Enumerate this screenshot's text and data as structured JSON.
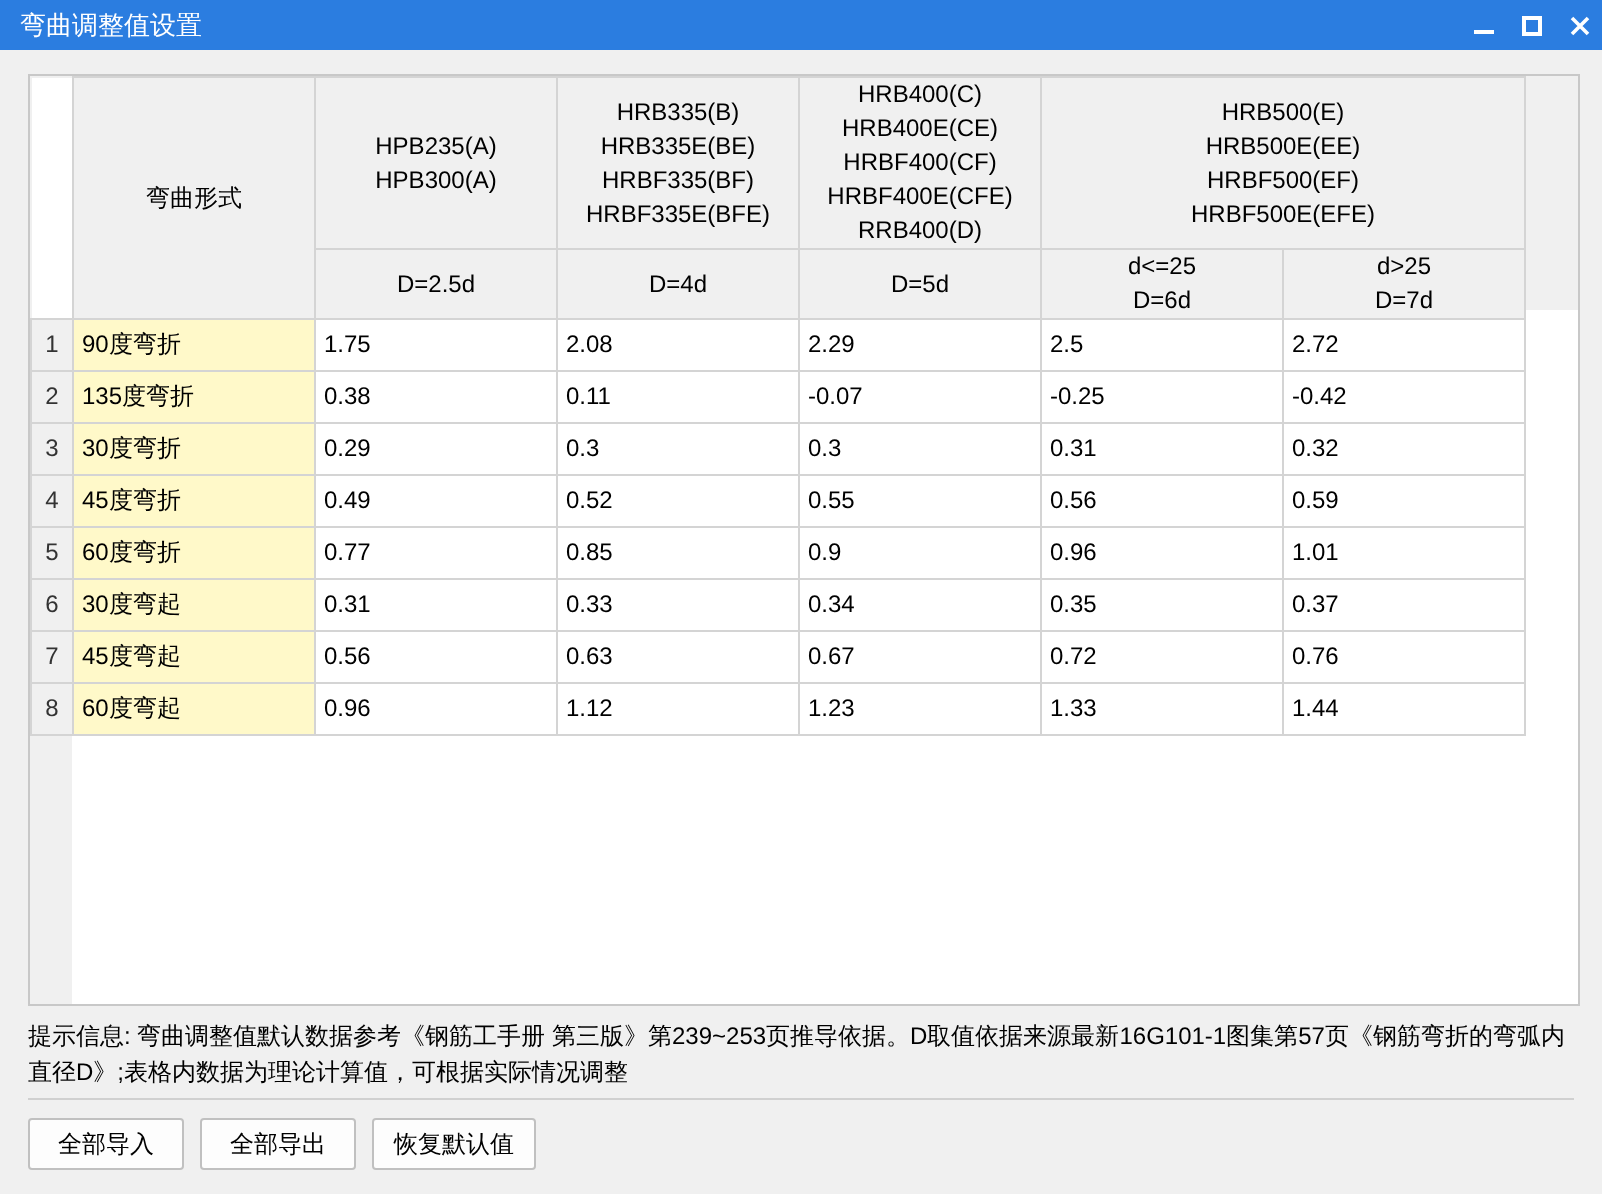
{
  "window": {
    "title": "弯曲调整值设置"
  },
  "table": {
    "name_header": "弯曲形式",
    "groups": [
      {
        "label": "HPB235(A)\nHPB300(A)",
        "sub_headers": [
          "D=2.5d"
        ]
      },
      {
        "label": "HRB335(B)\nHRB335E(BE)\nHRBF335(BF)\nHRBF335E(BFE)",
        "sub_headers": [
          "D=4d"
        ]
      },
      {
        "label": "HRB400(C)\nHRB400E(CE)\nHRBF400(CF)\nHRBF400E(CFE)\nRRB400(D)",
        "sub_headers": [
          "D=5d"
        ]
      },
      {
        "label": "HRB500(E)\nHRB500E(EE)\nHRBF500(EF)\nHRBF500E(EFE)",
        "sub_headers": [
          "d<=25\nD=6d",
          "d>25\nD=7d"
        ]
      }
    ],
    "rows": [
      {
        "number": "1",
        "name": "90度弯折",
        "values": [
          "1.75",
          "2.08",
          "2.29",
          "2.5",
          "2.72"
        ]
      },
      {
        "number": "2",
        "name": "135度弯折",
        "values": [
          "0.38",
          "0.11",
          "-0.07",
          "-0.25",
          "-0.42"
        ]
      },
      {
        "number": "3",
        "name": "30度弯折",
        "values": [
          "0.29",
          "0.3",
          "0.3",
          "0.31",
          "0.32"
        ]
      },
      {
        "number": "4",
        "name": "45度弯折",
        "values": [
          "0.49",
          "0.52",
          "0.55",
          "0.56",
          "0.59"
        ]
      },
      {
        "number": "5",
        "name": "60度弯折",
        "values": [
          "0.77",
          "0.85",
          "0.9",
          "0.96",
          "1.01"
        ]
      },
      {
        "number": "6",
        "name": "30度弯起",
        "values": [
          "0.31",
          "0.33",
          "0.34",
          "0.35",
          "0.37"
        ]
      },
      {
        "number": "7",
        "name": "45度弯起",
        "values": [
          "0.56",
          "0.63",
          "0.67",
          "0.72",
          "0.76"
        ]
      },
      {
        "number": "8",
        "name": "60度弯起",
        "values": [
          "0.96",
          "1.12",
          "1.23",
          "1.33",
          "1.44"
        ]
      }
    ]
  },
  "hint": "提示信息: 弯曲调整值默认数据参考《钢筋工手册 第三版》第239~253页推导依据。D取值依据来源最新16G101-1图集第57页《钢筋弯折的弯弧内直径D》;表格内数据为理论计算值，可根据实际情况调整",
  "buttons": [
    "全部导入",
    "全部导出",
    "恢复默认值"
  ]
}
